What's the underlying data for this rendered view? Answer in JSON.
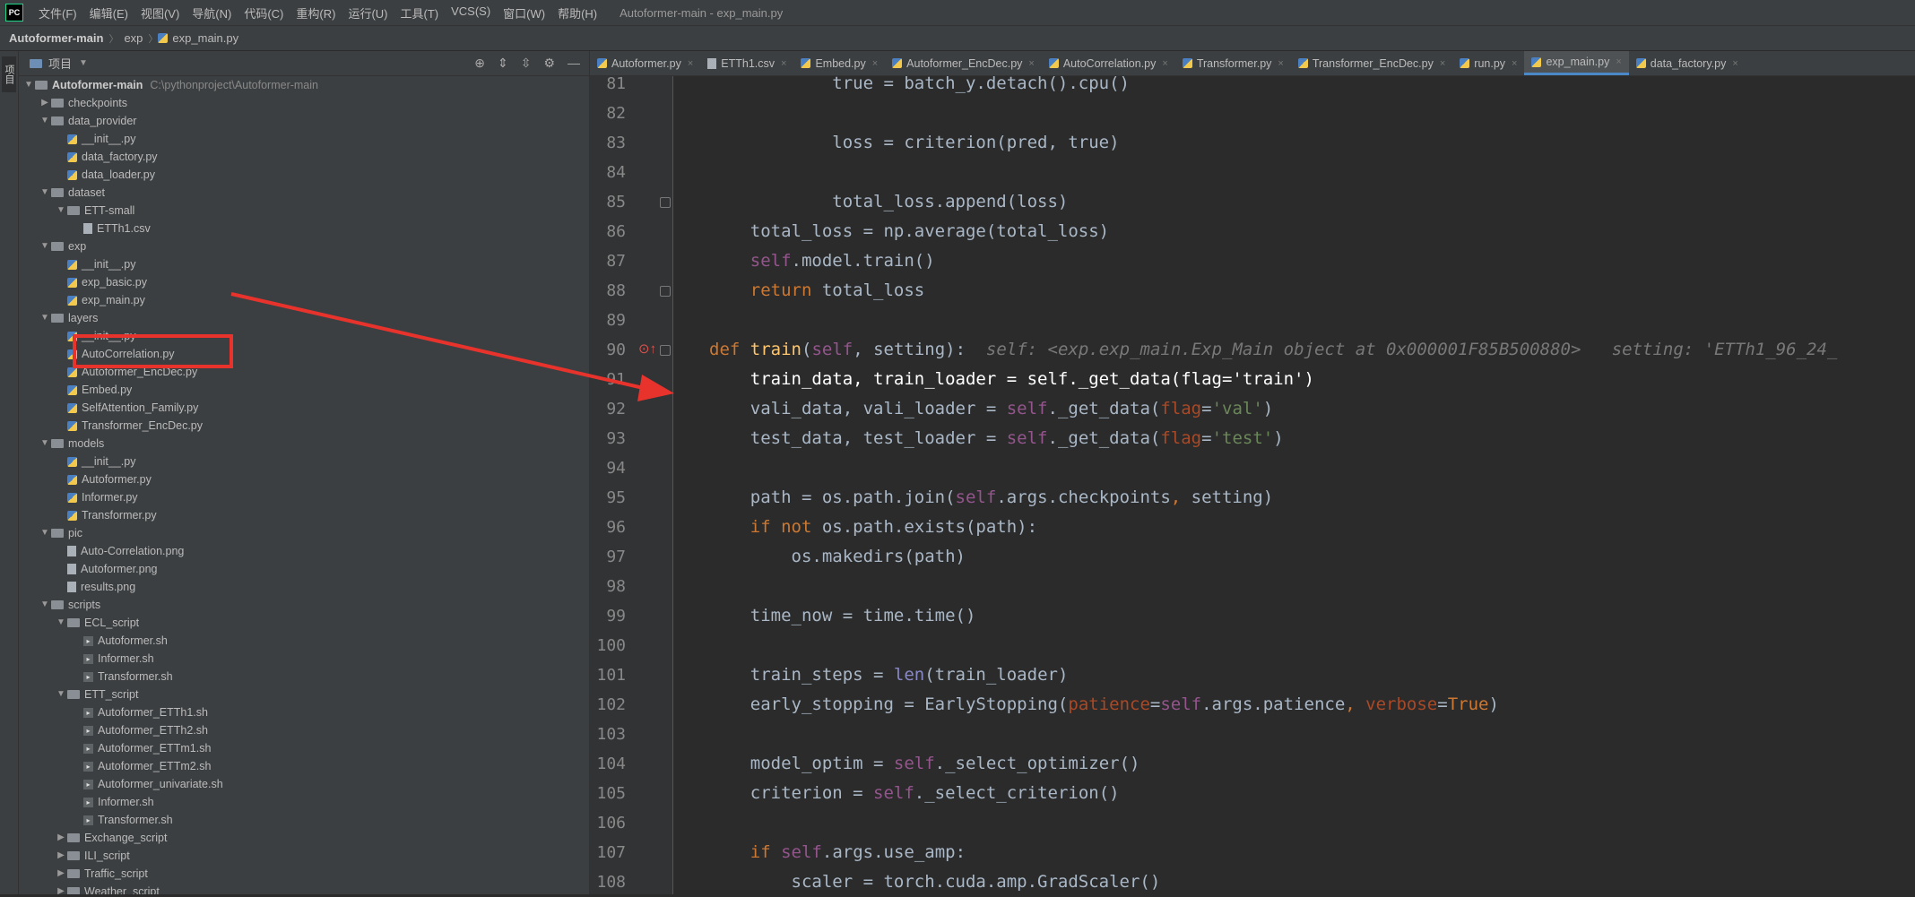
{
  "menubar": {
    "logo": "PC",
    "items": [
      "文件(F)",
      "编辑(E)",
      "视图(V)",
      "导航(N)",
      "代码(C)",
      "重构(R)",
      "运行(U)",
      "工具(T)",
      "VCS(S)",
      "窗口(W)",
      "帮助(H)"
    ],
    "window_title": "Autoformer-main - exp_main.py"
  },
  "breadcrumb": {
    "root": "Autoformer-main",
    "folder": "exp",
    "file": "exp_main.py"
  },
  "left_stripe": {
    "project_label": "项目"
  },
  "project_panel": {
    "title": "项目",
    "root_name": "Autoformer-main",
    "root_path": "C:\\pythonproject\\Autoformer-main",
    "tree": [
      {
        "label": "checkpoints",
        "type": "folder",
        "depth": 1,
        "state": "collapsed"
      },
      {
        "label": "data_provider",
        "type": "folder",
        "depth": 1,
        "state": "expanded"
      },
      {
        "label": "__init__.py",
        "type": "py",
        "depth": 2
      },
      {
        "label": "data_factory.py",
        "type": "py",
        "depth": 2
      },
      {
        "label": "data_loader.py",
        "type": "py",
        "depth": 2
      },
      {
        "label": "dataset",
        "type": "folder",
        "depth": 1,
        "state": "expanded"
      },
      {
        "label": "ETT-small",
        "type": "folder",
        "depth": 2,
        "state": "expanded"
      },
      {
        "label": "ETTh1.csv",
        "type": "file",
        "depth": 3
      },
      {
        "label": "exp",
        "type": "folder",
        "depth": 1,
        "state": "expanded"
      },
      {
        "label": "__init__.py",
        "type": "py",
        "depth": 2
      },
      {
        "label": "exp_basic.py",
        "type": "py",
        "depth": 2
      },
      {
        "label": "exp_main.py",
        "type": "py",
        "depth": 2
      },
      {
        "label": "layers",
        "type": "folder",
        "depth": 1,
        "state": "expanded"
      },
      {
        "label": "__init__.py",
        "type": "py",
        "depth": 2
      },
      {
        "label": "AutoCorrelation.py",
        "type": "py",
        "depth": 2
      },
      {
        "label": "Autoformer_EncDec.py",
        "type": "py",
        "depth": 2
      },
      {
        "label": "Embed.py",
        "type": "py",
        "depth": 2
      },
      {
        "label": "SelfAttention_Family.py",
        "type": "py",
        "depth": 2
      },
      {
        "label": "Transformer_EncDec.py",
        "type": "py",
        "depth": 2
      },
      {
        "label": "models",
        "type": "folder",
        "depth": 1,
        "state": "expanded"
      },
      {
        "label": "__init__.py",
        "type": "py",
        "depth": 2
      },
      {
        "label": "Autoformer.py",
        "type": "py",
        "depth": 2
      },
      {
        "label": "Informer.py",
        "type": "py",
        "depth": 2
      },
      {
        "label": "Transformer.py",
        "type": "py",
        "depth": 2
      },
      {
        "label": "pic",
        "type": "folder",
        "depth": 1,
        "state": "expanded"
      },
      {
        "label": "Auto-Correlation.png",
        "type": "file",
        "depth": 2
      },
      {
        "label": "Autoformer.png",
        "type": "file",
        "depth": 2
      },
      {
        "label": "results.png",
        "type": "file",
        "depth": 2
      },
      {
        "label": "scripts",
        "type": "folder",
        "depth": 1,
        "state": "expanded"
      },
      {
        "label": "ECL_script",
        "type": "folder",
        "depth": 2,
        "state": "expanded"
      },
      {
        "label": "Autoformer.sh",
        "type": "sh",
        "depth": 3
      },
      {
        "label": "Informer.sh",
        "type": "sh",
        "depth": 3
      },
      {
        "label": "Transformer.sh",
        "type": "sh",
        "depth": 3
      },
      {
        "label": "ETT_script",
        "type": "folder",
        "depth": 2,
        "state": "expanded"
      },
      {
        "label": "Autoformer_ETTh1.sh",
        "type": "sh",
        "depth": 3
      },
      {
        "label": "Autoformer_ETTh2.sh",
        "type": "sh",
        "depth": 3
      },
      {
        "label": "Autoformer_ETTm1.sh",
        "type": "sh",
        "depth": 3
      },
      {
        "label": "Autoformer_ETTm2.sh",
        "type": "sh",
        "depth": 3
      },
      {
        "label": "Autoformer_univariate.sh",
        "type": "sh",
        "depth": 3
      },
      {
        "label": "Informer.sh",
        "type": "sh",
        "depth": 3
      },
      {
        "label": "Transformer.sh",
        "type": "sh",
        "depth": 3
      },
      {
        "label": "Exchange_script",
        "type": "folder",
        "depth": 2,
        "state": "collapsed"
      },
      {
        "label": "ILI_script",
        "type": "folder",
        "depth": 2,
        "state": "collapsed"
      },
      {
        "label": "Traffic_script",
        "type": "folder",
        "depth": 2,
        "state": "collapsed"
      },
      {
        "label": "Weather_script",
        "type": "folder",
        "depth": 2,
        "state": "collapsed"
      }
    ]
  },
  "tabs": [
    {
      "label": "Autoformer.py",
      "active": false
    },
    {
      "label": "ETTh1.csv",
      "active": false
    },
    {
      "label": "Embed.py",
      "active": false
    },
    {
      "label": "Autoformer_EncDec.py",
      "active": false
    },
    {
      "label": "AutoCorrelation.py",
      "active": false
    },
    {
      "label": "Transformer.py",
      "active": false
    },
    {
      "label": "Transformer_EncDec.py",
      "active": false
    },
    {
      "label": "run.py",
      "active": false
    },
    {
      "label": "exp_main.py",
      "active": true
    },
    {
      "label": "data_factory.py",
      "active": false
    }
  ],
  "editor": {
    "highlighted_line": 91,
    "lines": [
      {
        "n": "81",
        "html": "            true = batch_y.detach().cpu()"
      },
      {
        "n": "82",
        "html": ""
      },
      {
        "n": "83",
        "html": "            loss = criterion(pred, true)"
      },
      {
        "n": "84",
        "html": ""
      },
      {
        "n": "85",
        "html": "            total_loss.append(loss)"
      },
      {
        "n": "86",
        "html": "    total_loss = np.average(total_loss)"
      },
      {
        "n": "87",
        "html": "    <span class='slf'>self</span>.model.train()"
      },
      {
        "n": "88",
        "html": "    <span class='kw'>return</span> total_loss"
      },
      {
        "n": "89",
        "html": ""
      },
      {
        "n": "90",
        "html": "<span class='kw'>def</span> <span class='fn'>train</span>(<span class='slf'>self</span>, setting):  <span class='hint'>self: &lt;exp.exp_main.Exp_Main object at 0x000001F85B500880&gt;   setting: 'ETTh1_96_24_</span>"
      },
      {
        "n": "91",
        "html": "    train_data, train_loader = self._get_data(flag='train')"
      },
      {
        "n": "92",
        "html": "    vali_data, vali_loader = <span class='slf'>self</span>._get_data(<span class='par'>flag</span>=<span class='str'>'val'</span>)"
      },
      {
        "n": "93",
        "html": "    test_data, test_loader = <span class='slf'>self</span>._get_data(<span class='par'>flag</span>=<span class='str'>'test'</span>)"
      },
      {
        "n": "94",
        "html": ""
      },
      {
        "n": "95",
        "html": "    path = os.path.join(<span class='slf'>self</span>.args.checkpoints<span class='kw'>,</span> setting)"
      },
      {
        "n": "96",
        "html": "    <span class='kw'>if not</span> os.path.exists(path):"
      },
      {
        "n": "97",
        "html": "        os.makedirs(path)"
      },
      {
        "n": "98",
        "html": ""
      },
      {
        "n": "99",
        "html": "    time_now = time.time()"
      },
      {
        "n": "100",
        "html": ""
      },
      {
        "n": "101",
        "html": "    train_steps = <span class='bi'>len</span>(train_loader)"
      },
      {
        "n": "102",
        "html": "    early_stopping = EarlyStopping(<span class='par'>patience</span>=<span class='slf'>self</span>.args.patience<span class='kw'>,</span> <span class='par'>verbose</span>=<span class='kw'>True</span>)"
      },
      {
        "n": "103",
        "html": ""
      },
      {
        "n": "104",
        "html": "    model_optim = <span class='slf'>self</span>._select_optimizer()"
      },
      {
        "n": "105",
        "html": "    criterion = <span class='slf'>self</span>._select_criterion()"
      },
      {
        "n": "106",
        "html": ""
      },
      {
        "n": "107",
        "html": "    <span class='kw'>if</span> <span class='slf'>self</span>.args.use_amp:"
      },
      {
        "n": "108",
        "html": "        scaler = torch.cuda.amp.GradScaler()"
      }
    ]
  },
  "colors": {
    "highlight": "#2d5bb0",
    "annotation_red": "#e8332d",
    "active_tab_underline": "#4a88c7"
  }
}
